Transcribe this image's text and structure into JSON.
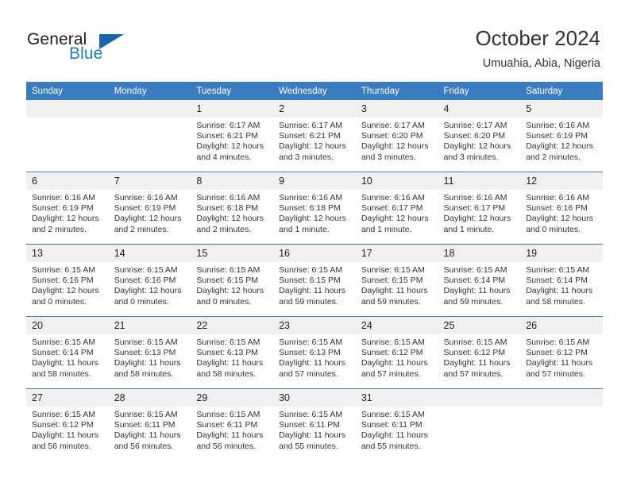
{
  "brand": {
    "name_part1": "General",
    "name_part2": "Blue",
    "accent_color": "#1f7ac4",
    "triangle_color": "#1565b0"
  },
  "header": {
    "title": "October 2024",
    "subtitle": "Umuahia, Abia, Nigeria"
  },
  "calendar": {
    "header_bg": "#3b7cc0",
    "daynum_bg": "#f0f0f0",
    "weekdays": [
      "Sunday",
      "Monday",
      "Tuesday",
      "Wednesday",
      "Thursday",
      "Friday",
      "Saturday"
    ],
    "weeks": [
      [
        {
          "day": "",
          "sunrise": "",
          "sunset": "",
          "daylight1": "",
          "daylight2": ""
        },
        {
          "day": "",
          "sunrise": "",
          "sunset": "",
          "daylight1": "",
          "daylight2": ""
        },
        {
          "day": "1",
          "sunrise": "Sunrise: 6:17 AM",
          "sunset": "Sunset: 6:21 PM",
          "daylight1": "Daylight: 12 hours",
          "daylight2": "and 4 minutes."
        },
        {
          "day": "2",
          "sunrise": "Sunrise: 6:17 AM",
          "sunset": "Sunset: 6:21 PM",
          "daylight1": "Daylight: 12 hours",
          "daylight2": "and 3 minutes."
        },
        {
          "day": "3",
          "sunrise": "Sunrise: 6:17 AM",
          "sunset": "Sunset: 6:20 PM",
          "daylight1": "Daylight: 12 hours",
          "daylight2": "and 3 minutes."
        },
        {
          "day": "4",
          "sunrise": "Sunrise: 6:17 AM",
          "sunset": "Sunset: 6:20 PM",
          "daylight1": "Daylight: 12 hours",
          "daylight2": "and 3 minutes."
        },
        {
          "day": "5",
          "sunrise": "Sunrise: 6:16 AM",
          "sunset": "Sunset: 6:19 PM",
          "daylight1": "Daylight: 12 hours",
          "daylight2": "and 2 minutes."
        }
      ],
      [
        {
          "day": "6",
          "sunrise": "Sunrise: 6:16 AM",
          "sunset": "Sunset: 6:19 PM",
          "daylight1": "Daylight: 12 hours",
          "daylight2": "and 2 minutes."
        },
        {
          "day": "7",
          "sunrise": "Sunrise: 6:16 AM",
          "sunset": "Sunset: 6:19 PM",
          "daylight1": "Daylight: 12 hours",
          "daylight2": "and 2 minutes."
        },
        {
          "day": "8",
          "sunrise": "Sunrise: 6:16 AM",
          "sunset": "Sunset: 6:18 PM",
          "daylight1": "Daylight: 12 hours",
          "daylight2": "and 2 minutes."
        },
        {
          "day": "9",
          "sunrise": "Sunrise: 6:16 AM",
          "sunset": "Sunset: 6:18 PM",
          "daylight1": "Daylight: 12 hours",
          "daylight2": "and 1 minute."
        },
        {
          "day": "10",
          "sunrise": "Sunrise: 6:16 AM",
          "sunset": "Sunset: 6:17 PM",
          "daylight1": "Daylight: 12 hours",
          "daylight2": "and 1 minute."
        },
        {
          "day": "11",
          "sunrise": "Sunrise: 6:16 AM",
          "sunset": "Sunset: 6:17 PM",
          "daylight1": "Daylight: 12 hours",
          "daylight2": "and 1 minute."
        },
        {
          "day": "12",
          "sunrise": "Sunrise: 6:16 AM",
          "sunset": "Sunset: 6:16 PM",
          "daylight1": "Daylight: 12 hours",
          "daylight2": "and 0 minutes."
        }
      ],
      [
        {
          "day": "13",
          "sunrise": "Sunrise: 6:15 AM",
          "sunset": "Sunset: 6:16 PM",
          "daylight1": "Daylight: 12 hours",
          "daylight2": "and 0 minutes."
        },
        {
          "day": "14",
          "sunrise": "Sunrise: 6:15 AM",
          "sunset": "Sunset: 6:16 PM",
          "daylight1": "Daylight: 12 hours",
          "daylight2": "and 0 minutes."
        },
        {
          "day": "15",
          "sunrise": "Sunrise: 6:15 AM",
          "sunset": "Sunset: 6:15 PM",
          "daylight1": "Daylight: 12 hours",
          "daylight2": "and 0 minutes."
        },
        {
          "day": "16",
          "sunrise": "Sunrise: 6:15 AM",
          "sunset": "Sunset: 6:15 PM",
          "daylight1": "Daylight: 11 hours",
          "daylight2": "and 59 minutes."
        },
        {
          "day": "17",
          "sunrise": "Sunrise: 6:15 AM",
          "sunset": "Sunset: 6:15 PM",
          "daylight1": "Daylight: 11 hours",
          "daylight2": "and 59 minutes."
        },
        {
          "day": "18",
          "sunrise": "Sunrise: 6:15 AM",
          "sunset": "Sunset: 6:14 PM",
          "daylight1": "Daylight: 11 hours",
          "daylight2": "and 59 minutes."
        },
        {
          "day": "19",
          "sunrise": "Sunrise: 6:15 AM",
          "sunset": "Sunset: 6:14 PM",
          "daylight1": "Daylight: 11 hours",
          "daylight2": "and 58 minutes."
        }
      ],
      [
        {
          "day": "20",
          "sunrise": "Sunrise: 6:15 AM",
          "sunset": "Sunset: 6:14 PM",
          "daylight1": "Daylight: 11 hours",
          "daylight2": "and 58 minutes."
        },
        {
          "day": "21",
          "sunrise": "Sunrise: 6:15 AM",
          "sunset": "Sunset: 6:13 PM",
          "daylight1": "Daylight: 11 hours",
          "daylight2": "and 58 minutes."
        },
        {
          "day": "22",
          "sunrise": "Sunrise: 6:15 AM",
          "sunset": "Sunset: 6:13 PM",
          "daylight1": "Daylight: 11 hours",
          "daylight2": "and 58 minutes."
        },
        {
          "day": "23",
          "sunrise": "Sunrise: 6:15 AM",
          "sunset": "Sunset: 6:13 PM",
          "daylight1": "Daylight: 11 hours",
          "daylight2": "and 57 minutes."
        },
        {
          "day": "24",
          "sunrise": "Sunrise: 6:15 AM",
          "sunset": "Sunset: 6:12 PM",
          "daylight1": "Daylight: 11 hours",
          "daylight2": "and 57 minutes."
        },
        {
          "day": "25",
          "sunrise": "Sunrise: 6:15 AM",
          "sunset": "Sunset: 6:12 PM",
          "daylight1": "Daylight: 11 hours",
          "daylight2": "and 57 minutes."
        },
        {
          "day": "26",
          "sunrise": "Sunrise: 6:15 AM",
          "sunset": "Sunset: 6:12 PM",
          "daylight1": "Daylight: 11 hours",
          "daylight2": "and 57 minutes."
        }
      ],
      [
        {
          "day": "27",
          "sunrise": "Sunrise: 6:15 AM",
          "sunset": "Sunset: 6:12 PM",
          "daylight1": "Daylight: 11 hours",
          "daylight2": "and 56 minutes."
        },
        {
          "day": "28",
          "sunrise": "Sunrise: 6:15 AM",
          "sunset": "Sunset: 6:11 PM",
          "daylight1": "Daylight: 11 hours",
          "daylight2": "and 56 minutes."
        },
        {
          "day": "29",
          "sunrise": "Sunrise: 6:15 AM",
          "sunset": "Sunset: 6:11 PM",
          "daylight1": "Daylight: 11 hours",
          "daylight2": "and 56 minutes."
        },
        {
          "day": "30",
          "sunrise": "Sunrise: 6:15 AM",
          "sunset": "Sunset: 6:11 PM",
          "daylight1": "Daylight: 11 hours",
          "daylight2": "and 55 minutes."
        },
        {
          "day": "31",
          "sunrise": "Sunrise: 6:15 AM",
          "sunset": "Sunset: 6:11 PM",
          "daylight1": "Daylight: 11 hours",
          "daylight2": "and 55 minutes."
        },
        {
          "day": "",
          "sunrise": "",
          "sunset": "",
          "daylight1": "",
          "daylight2": ""
        },
        {
          "day": "",
          "sunrise": "",
          "sunset": "",
          "daylight1": "",
          "daylight2": ""
        }
      ]
    ]
  }
}
